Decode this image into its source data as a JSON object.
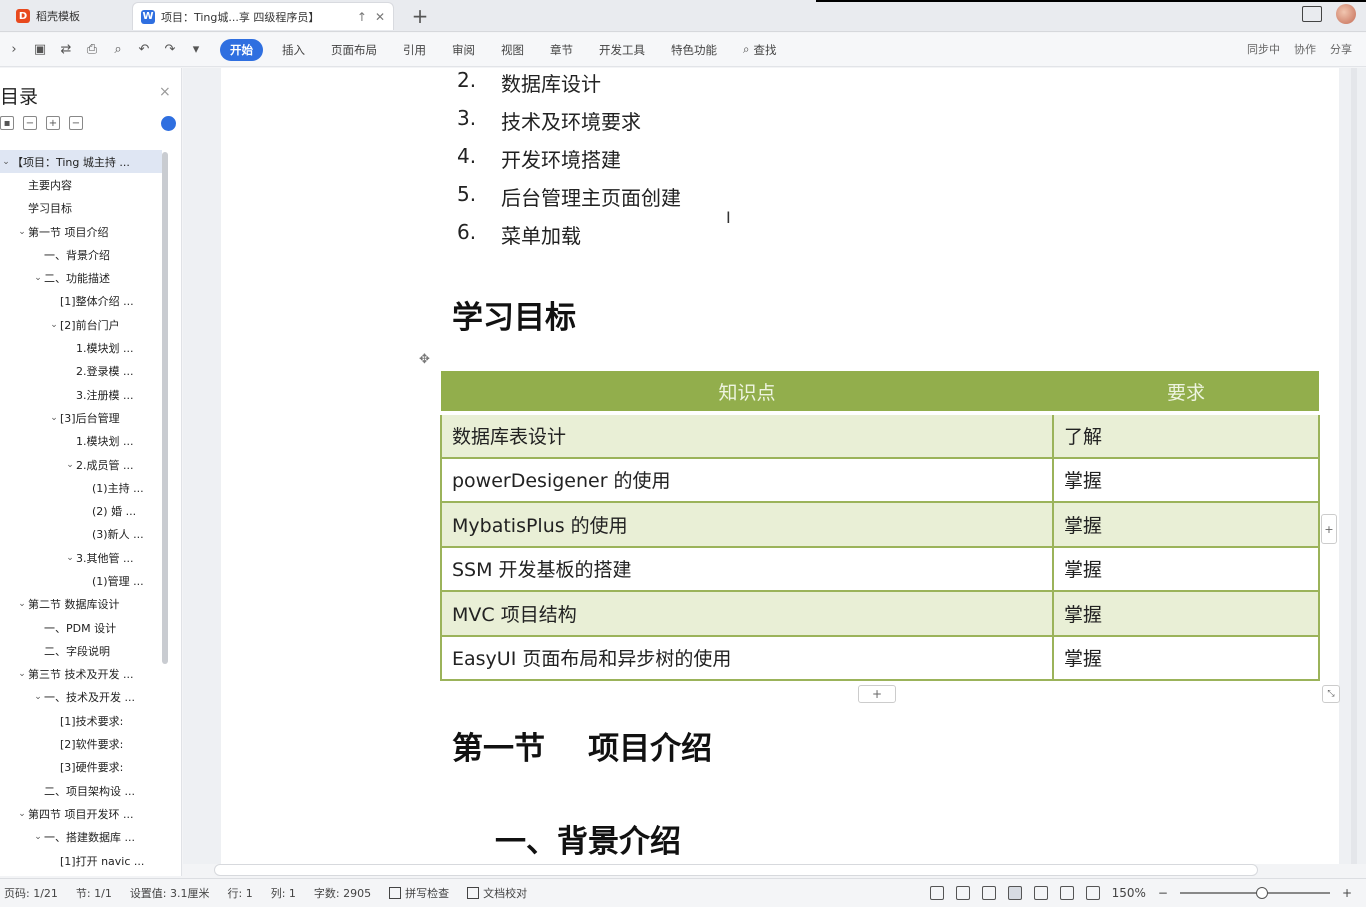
{
  "window": {
    "tabs": [
      {
        "label": "稻壳模板"
      },
      {
        "label": "项目：Ting城...享 四级程序员】"
      }
    ],
    "new_tab_label": "+"
  },
  "ribbon": {
    "menu": [
      {
        "label": "开始",
        "active": true
      },
      {
        "label": "插入"
      },
      {
        "label": "页面布局"
      },
      {
        "label": "引用"
      },
      {
        "label": "审阅"
      },
      {
        "label": "视图"
      },
      {
        "label": "章节"
      },
      {
        "label": "开发工具"
      },
      {
        "label": "特色功能"
      }
    ],
    "search_label": "查找",
    "right_actions": [
      "同步中",
      "协作",
      "分享"
    ]
  },
  "nav": {
    "title": "目录",
    "close": "×",
    "items": [
      {
        "label": "【项目：Ting 城主持 ...",
        "level": 0,
        "arrow": "v",
        "selected": true
      },
      {
        "label": "主要内容",
        "level": 1,
        "arrow": ""
      },
      {
        "label": "学习目标",
        "level": 1,
        "arrow": ""
      },
      {
        "label": "第一节 项目介绍",
        "level": 1,
        "arrow": "v"
      },
      {
        "label": "一、背景介绍",
        "level": 2,
        "arrow": ""
      },
      {
        "label": "二、功能描述",
        "level": 2,
        "arrow": "v"
      },
      {
        "label": "[1]整体介绍 ...",
        "level": 3,
        "arrow": ""
      },
      {
        "label": "[2]前台门户",
        "level": 3,
        "arrow": "v"
      },
      {
        "label": "1.模块划 ...",
        "level": 4,
        "arrow": ""
      },
      {
        "label": "2.登录模 ...",
        "level": 4,
        "arrow": ""
      },
      {
        "label": "3.注册模 ...",
        "level": 4,
        "arrow": ""
      },
      {
        "label": "[3]后台管理",
        "level": 3,
        "arrow": "v"
      },
      {
        "label": "1.模块划 ...",
        "level": 4,
        "arrow": ""
      },
      {
        "label": "2.成员管 ...",
        "level": 4,
        "arrow": "v"
      },
      {
        "label": "(1)主持 ...",
        "level": 5,
        "arrow": ""
      },
      {
        "label": "(2) 婚 ...",
        "level": 5,
        "arrow": ""
      },
      {
        "label": "(3)新人 ...",
        "level": 5,
        "arrow": ""
      },
      {
        "label": "3.其他管 ...",
        "level": 4,
        "arrow": "v"
      },
      {
        "label": "(1)管理 ...",
        "level": 5,
        "arrow": ""
      },
      {
        "label": "第二节 数据库设计",
        "level": 1,
        "arrow": "v"
      },
      {
        "label": "一、PDM 设计",
        "level": 2,
        "arrow": ""
      },
      {
        "label": "二、字段说明",
        "level": 2,
        "arrow": ""
      },
      {
        "label": "第三节 技术及开发 ...",
        "level": 1,
        "arrow": "v"
      },
      {
        "label": "一、技术及开发 ...",
        "level": 2,
        "arrow": "v"
      },
      {
        "label": "[1]技术要求:",
        "level": 3,
        "arrow": ""
      },
      {
        "label": "[2]软件要求:",
        "level": 3,
        "arrow": ""
      },
      {
        "label": "[3]硬件要求:",
        "level": 3,
        "arrow": ""
      },
      {
        "label": "二、项目架构设 ...",
        "level": 2,
        "arrow": ""
      },
      {
        "label": "第四节 项目开发环 ...",
        "level": 1,
        "arrow": "v"
      },
      {
        "label": "一、搭建数据库 ...",
        "level": 2,
        "arrow": "v"
      },
      {
        "label": "[1]打开 navic ...",
        "level": 3,
        "arrow": ""
      }
    ]
  },
  "doc": {
    "list": [
      {
        "num": "2.",
        "text": "数据库设计"
      },
      {
        "num": "3.",
        "text": "技术及环境要求"
      },
      {
        "num": "4.",
        "text": "开发环境搭建"
      },
      {
        "num": "5.",
        "text": "后台管理主页面创建"
      },
      {
        "num": "6.",
        "text": "菜单加载"
      }
    ],
    "goal_heading": "学习目标",
    "table": {
      "headers": [
        "知识点",
        "要求"
      ],
      "rows": [
        [
          "数据库表设计",
          "了解"
        ],
        [
          "powerDesigener 的使用",
          "掌握"
        ],
        [
          "MybatisPlus 的使用",
          "掌握"
        ],
        [
          "SSM 开发基板的搭建",
          "掌握"
        ],
        [
          "MVC 项目结构",
          "掌握"
        ],
        [
          "EasyUI 页面布局和异步树的使用",
          "掌握"
        ]
      ]
    },
    "section_heading": "第一节    项目介绍",
    "sub_heading": "一、背景介绍"
  },
  "status": {
    "page": "页码: 1/21",
    "section": "节: 1/1",
    "setting": "设置值: 3.1厘米",
    "row": "行: 1",
    "col": "列: 1",
    "words": "字数: 2905",
    "spell": "拼写检查",
    "proof": "文档校对",
    "zoom": "150%",
    "zoom_level": 0.55
  },
  "colors": {
    "accent": "#2f6fe0",
    "table_header": "#92ae4c",
    "table_band": "#e9efd6",
    "table_border": "#9bb35a"
  }
}
